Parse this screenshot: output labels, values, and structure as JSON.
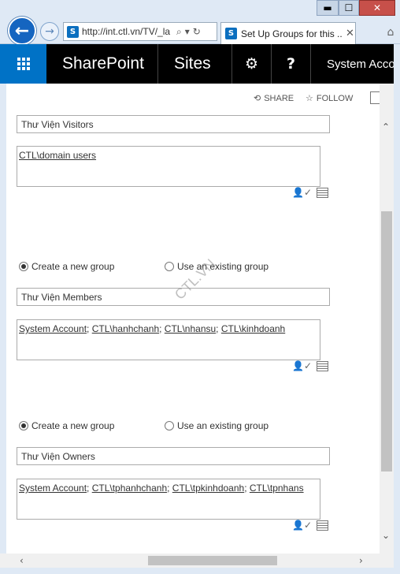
{
  "browser": {
    "url": "http://int.ctl.vn/TV/_la",
    "tab_title": "Set Up Groups for this ...",
    "window_min": "▬",
    "window_max": "☐",
    "window_close": "✕"
  },
  "suitebar": {
    "brand": "SharePoint",
    "sites": "Sites",
    "settings_icon": "gear-icon",
    "help_label": "?",
    "account": "System Account"
  },
  "page_actions": {
    "share": "SHARE",
    "follow": "FOLLOW"
  },
  "visitors": {
    "group_name": "Thư Viện Visitors",
    "members": [
      "CTL\\domain users"
    ]
  },
  "members_group": {
    "option_new": "Create a new group",
    "option_existing": "Use an existing group",
    "selected": "new",
    "group_name": "Thư Viện Members",
    "members": [
      "System Account",
      "CTL\\hanhchanh",
      "CTL\\nhansu",
      "CTL\\kinhdoanh"
    ]
  },
  "owners_group": {
    "option_new": "Create a new group",
    "option_existing": "Use an existing group",
    "selected": "new",
    "group_name": "Thư Viện Owners",
    "members": [
      "System Account",
      "CTL\\tphanhchanh",
      "CTL\\tpkinhdoanh",
      "CTL\\tpnhans"
    ]
  },
  "watermark": "CTL.VN",
  "colors": {
    "suite_blue": "#0072c6",
    "suite_bg": "#000000"
  }
}
